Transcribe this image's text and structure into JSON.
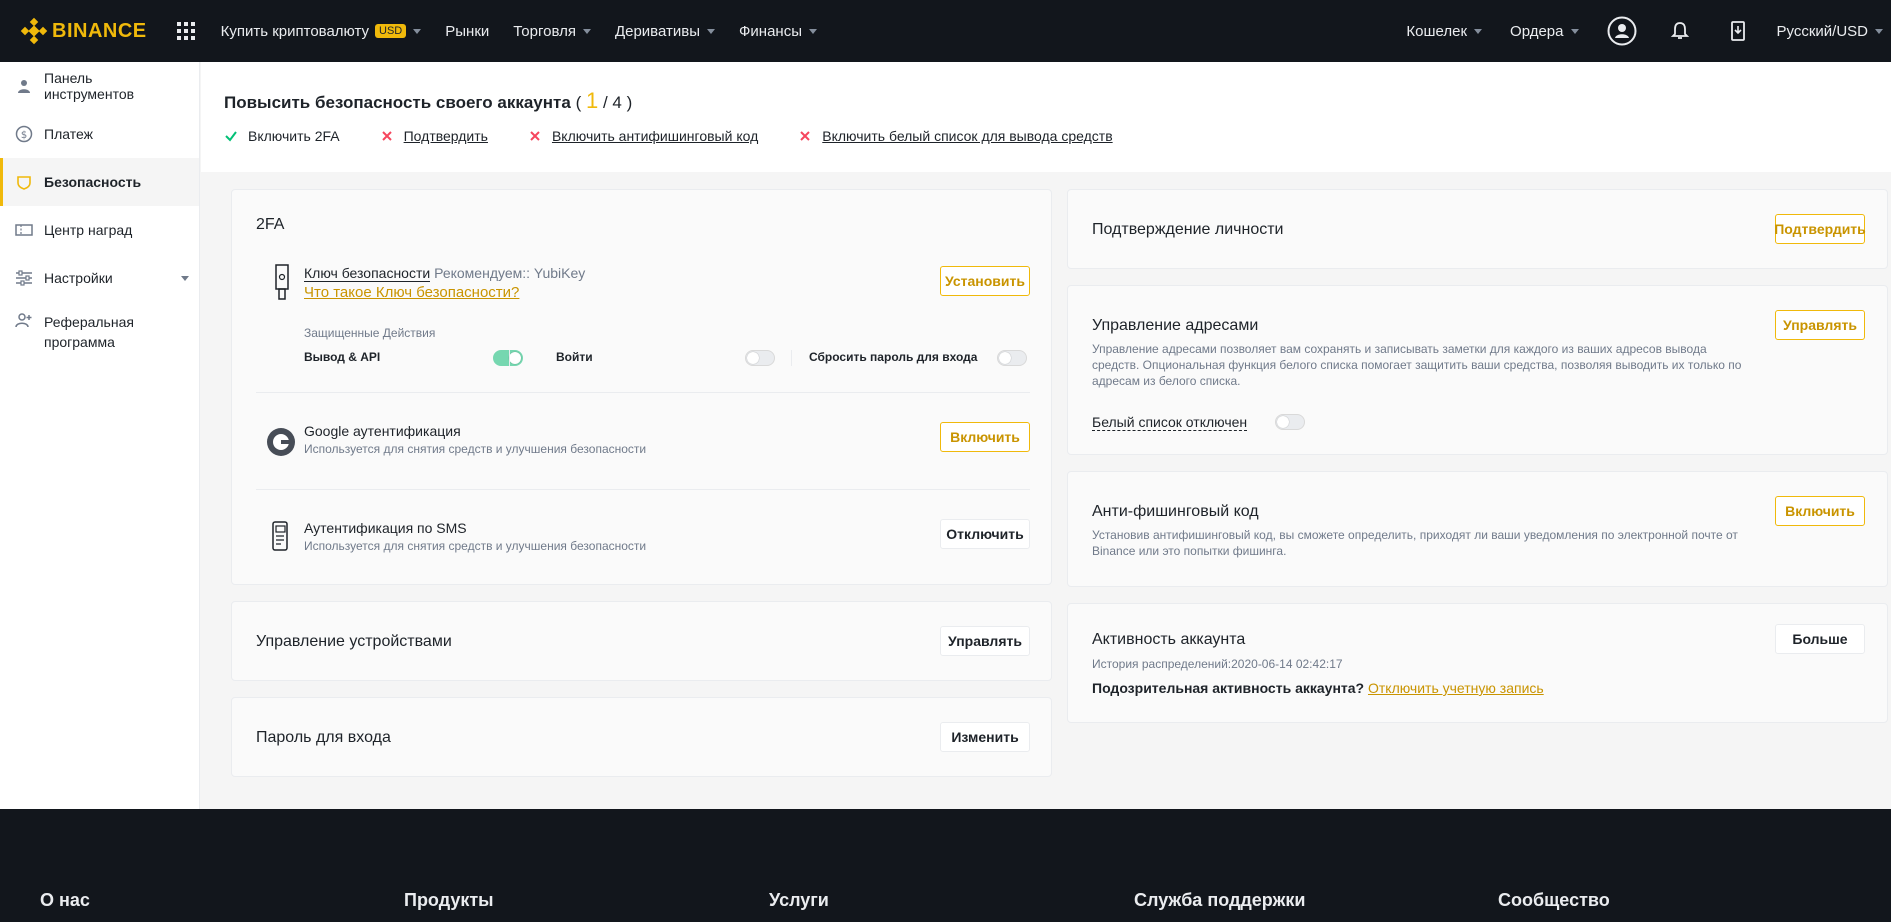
{
  "brand": {
    "name": "BINANCE",
    "accent": "#f0b90b"
  },
  "nav": {
    "buy_crypto": "Купить криптовалюту",
    "currency_badge": "USD",
    "markets": "Рынки",
    "trade": "Торговля",
    "derivatives": "Деривативы",
    "finance": "Финансы",
    "wallet": "Кошелек",
    "orders": "Ордера",
    "language": "Русский/USD",
    "icons": [
      "apps-grid-icon",
      "user-icon",
      "bell-icon",
      "download-icon"
    ]
  },
  "sidebar": {
    "items": [
      {
        "label": "Панель инструментов",
        "icon": "user-icon"
      },
      {
        "label": "Платеж",
        "icon": "dollar-icon"
      },
      {
        "label": "Безопасность",
        "icon": "shield-icon",
        "active": true
      },
      {
        "label": "Центр наград",
        "icon": "ticket-icon"
      },
      {
        "label": "Настройки",
        "icon": "sliders-icon"
      },
      {
        "label": "Реферальная программа",
        "label_line1": "Реферальная",
        "label_line2": "программа",
        "icon": "add-user-icon"
      }
    ]
  },
  "security_header": {
    "title": "Повысить безопасность своего аккаунта",
    "open_paren": "(",
    "done": "1",
    "total": "/ 4 )",
    "steps": [
      {
        "label": "Включить 2FA",
        "status": "done"
      },
      {
        "label": "Подтвердить",
        "status": "todo"
      },
      {
        "label": "Включить антифишинговый код",
        "status": "todo"
      },
      {
        "label": "Включить белый список для вывода средств",
        "status": "todo"
      }
    ]
  },
  "twofa": {
    "title": "2FA",
    "security_key": {
      "name": "Ключ безопасности",
      "recommend": "Рекомендуем:: YubiKey",
      "link": "Что такое Ключ безопасности?",
      "button": "Установить",
      "protected_title": "Защищенные Действия",
      "actions": [
        {
          "label": "Вывод & API",
          "enabled": true
        },
        {
          "label": "Войти",
          "enabled": false
        },
        {
          "label": "Сбросить пароль для входа",
          "enabled": false
        }
      ]
    },
    "google": {
      "name": "Google аутентификация",
      "desc": "Используется для снятия средств и улучшения безопасности",
      "button": "Включить"
    },
    "sms": {
      "name": "Аутентификация по SMS",
      "desc": "Используется для снятия средств и улучшения безопасности",
      "button": "Отключить"
    }
  },
  "devices": {
    "title": "Управление устройствами",
    "button": "Управлять"
  },
  "password": {
    "title": "Пароль для входа",
    "button": "Изменить"
  },
  "identity": {
    "title": "Подтверждение личности",
    "button": "Подтвердить"
  },
  "addresses": {
    "title": "Управление адресами",
    "desc": "Управление адресами позволяет вам сохранять и записывать заметки для каждого из ваших адресов вывода средств. Опциональная функция белого списка помогает защитить ваши средства, позволяя выводить их только по адресам из белого списка.",
    "button": "Управлять",
    "whitelist_label": "Белый список отключен",
    "whitelist_enabled": false
  },
  "antiphishing": {
    "title": "Анти-фишинговый код",
    "desc": "Установив антифишинговый код, вы сможете определить, приходят ли ваши уведомления по электронной почте от Binance или это попытки фишинга.",
    "button": "Включить"
  },
  "activity": {
    "title": "Активность аккаунта",
    "history": "История распределений:2020-06-14 02:42:17",
    "suspicious": "Подозрительная активность аккаунта?",
    "disable_link": "Отключить учетную запись",
    "button": "Больше"
  },
  "footer": {
    "columns": [
      "О нас",
      "Продукты",
      "Услуги",
      "Служба поддержки",
      "Сообщество"
    ]
  }
}
